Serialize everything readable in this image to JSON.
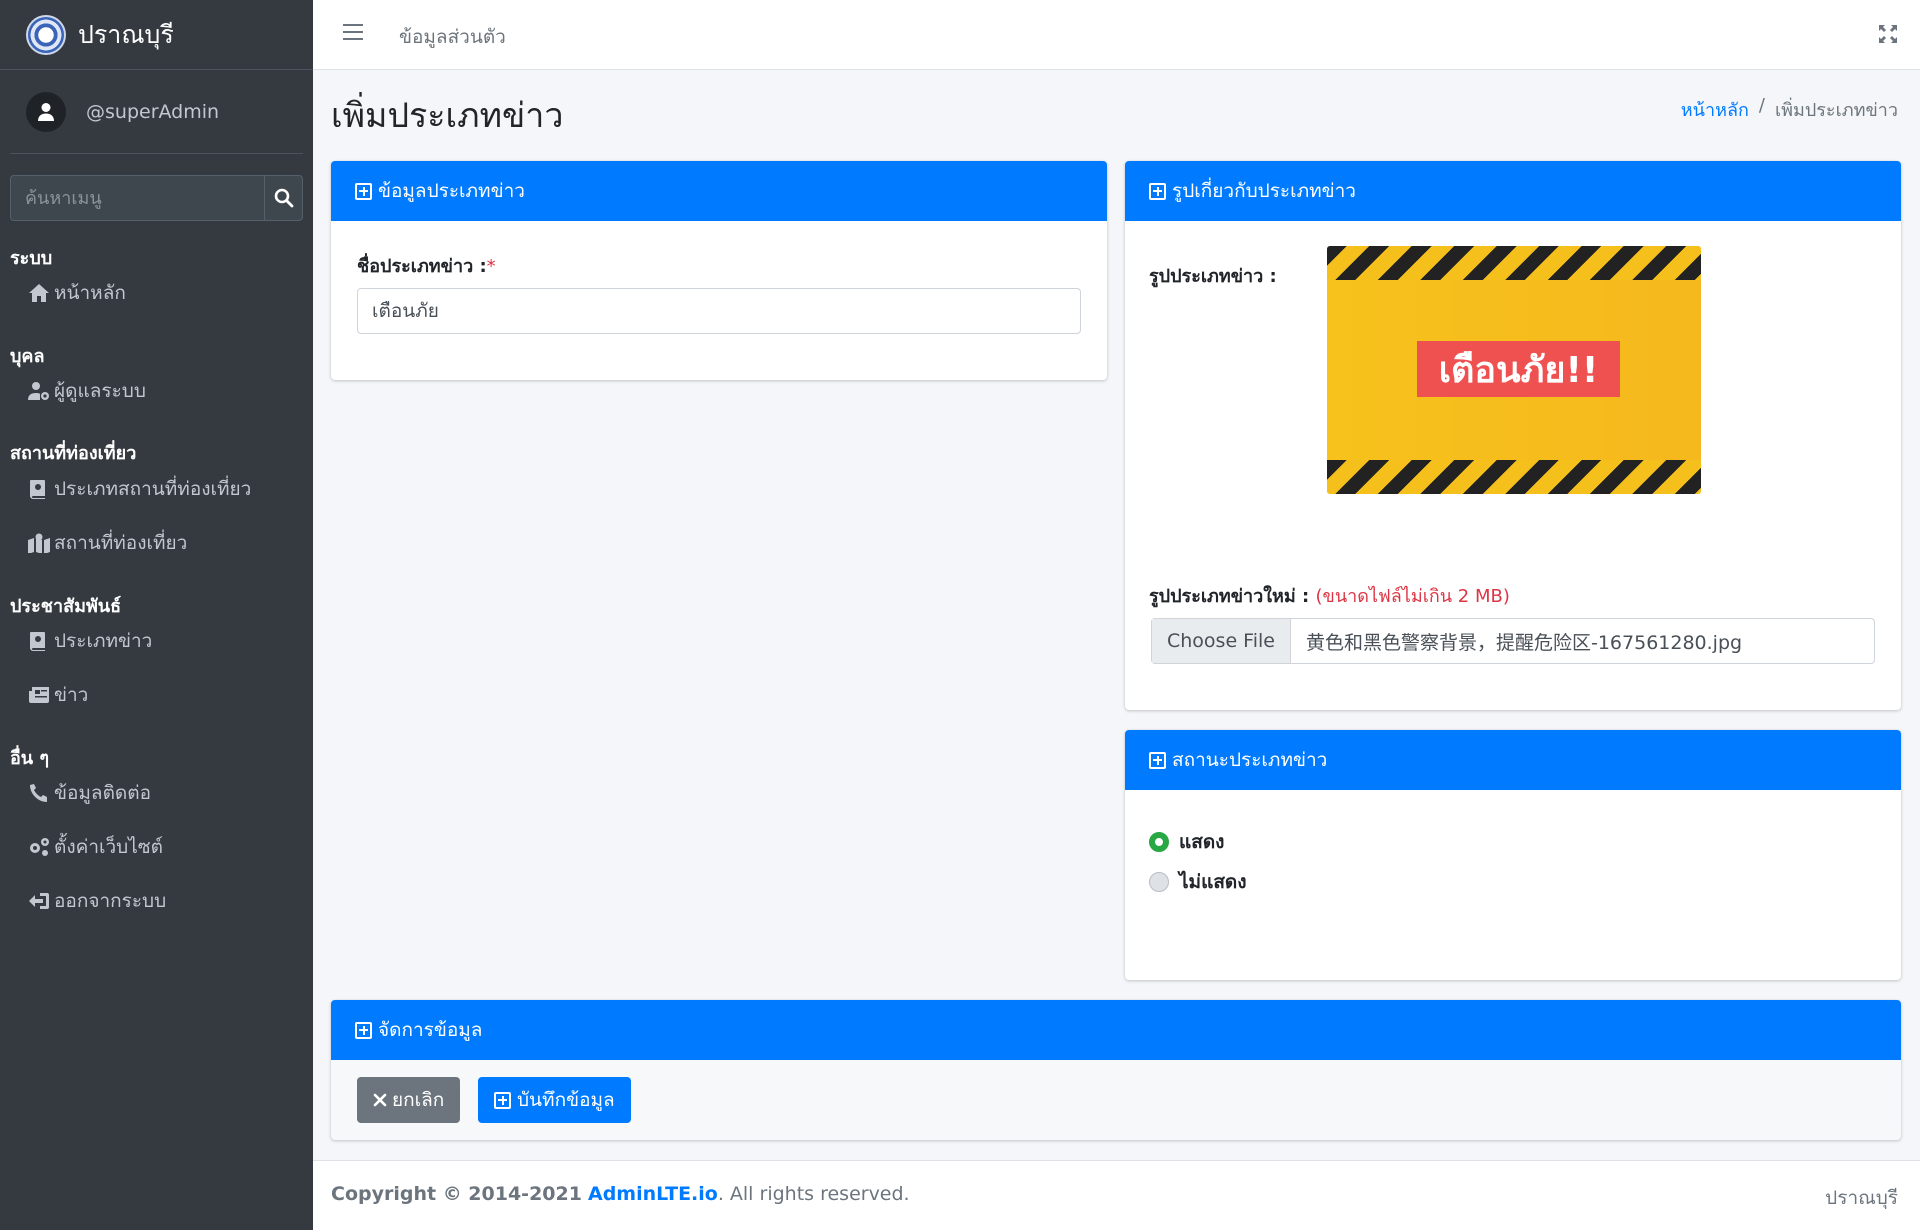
{
  "brand": {
    "name": "ปราณบุรี"
  },
  "user": {
    "name": "@superAdmin"
  },
  "search": {
    "placeholder": "ค้นหาเมนู"
  },
  "nav": {
    "headers": [
      "ระบบ",
      "บุคล",
      "สถานที่ท่องเที่ยว",
      "ประชาสัมพันธ์",
      "อื่น ๆ"
    ],
    "items": [
      {
        "label": "หน้าหลัก",
        "icon": "home-icon"
      },
      {
        "label": "ผู้ดูแลระบบ",
        "icon": "user-cog-icon"
      },
      {
        "label": "ประเภทสถานที่ท่องเที่ยว",
        "icon": "book-icon"
      },
      {
        "label": "สถานที่ท่องเที่ยว",
        "icon": "map-marked-icon"
      },
      {
        "label": "ประเภทข่าว",
        "icon": "book-icon"
      },
      {
        "label": "ข่าว",
        "icon": "newspaper-icon"
      },
      {
        "label": "ข้อมูลติดต่อ",
        "icon": "phone-icon"
      },
      {
        "label": "ตั้งค่าเว็บไซต์",
        "icon": "cogs-icon"
      },
      {
        "label": "ออกจากระบบ",
        "icon": "sign-out-icon"
      }
    ]
  },
  "topbar": {
    "link": "ข้อมูลส่วนตัว"
  },
  "page": {
    "title": "เพิ่มประเภทข่าว",
    "breadcrumb_home": "หน้าหลัก",
    "breadcrumb_sep": "/",
    "breadcrumb_current": "เพิ่มประเภทข่าว"
  },
  "info_card": {
    "header": "ข้อมูลประเภทข่าว",
    "name_label": "ชื่อประเภทข่าว :",
    "required_mark": "*",
    "name_value": "เตือนภัย"
  },
  "image_card": {
    "header": "รูปเกี่ยวกับประเภทข่าว",
    "current_label": "รูปประเภทข่าว :",
    "image_text": "เตือนภัย!!",
    "new_label": "รูปประเภทข่าวใหม่ :",
    "new_note": "(ขนาดไฟล์ไม่เกิน 2 MB)",
    "file_button": "Choose File",
    "file_name": "黄色和黑色警察背景，提醒危险区-167561280.jpg"
  },
  "status_card": {
    "header": "สถานะประเภทข่าว",
    "options": [
      {
        "label": "แสดง",
        "checked": true
      },
      {
        "label": "ไม่แสดง",
        "checked": false
      }
    ]
  },
  "manage_card": {
    "header": "จัดการข้อมูล",
    "cancel": "ยกเลิก",
    "save": "บันทึกข้อมูล"
  },
  "footer": {
    "copyright": "Copyright © 2014-2021",
    "site": "AdminLTE.io",
    "rights": ". All rights reserved.",
    "right": "ปราณบุรี"
  },
  "colors": {
    "primary": "#007bff",
    "sidebar": "#343a40",
    "success": "#28a745",
    "danger": "#dc3545"
  }
}
